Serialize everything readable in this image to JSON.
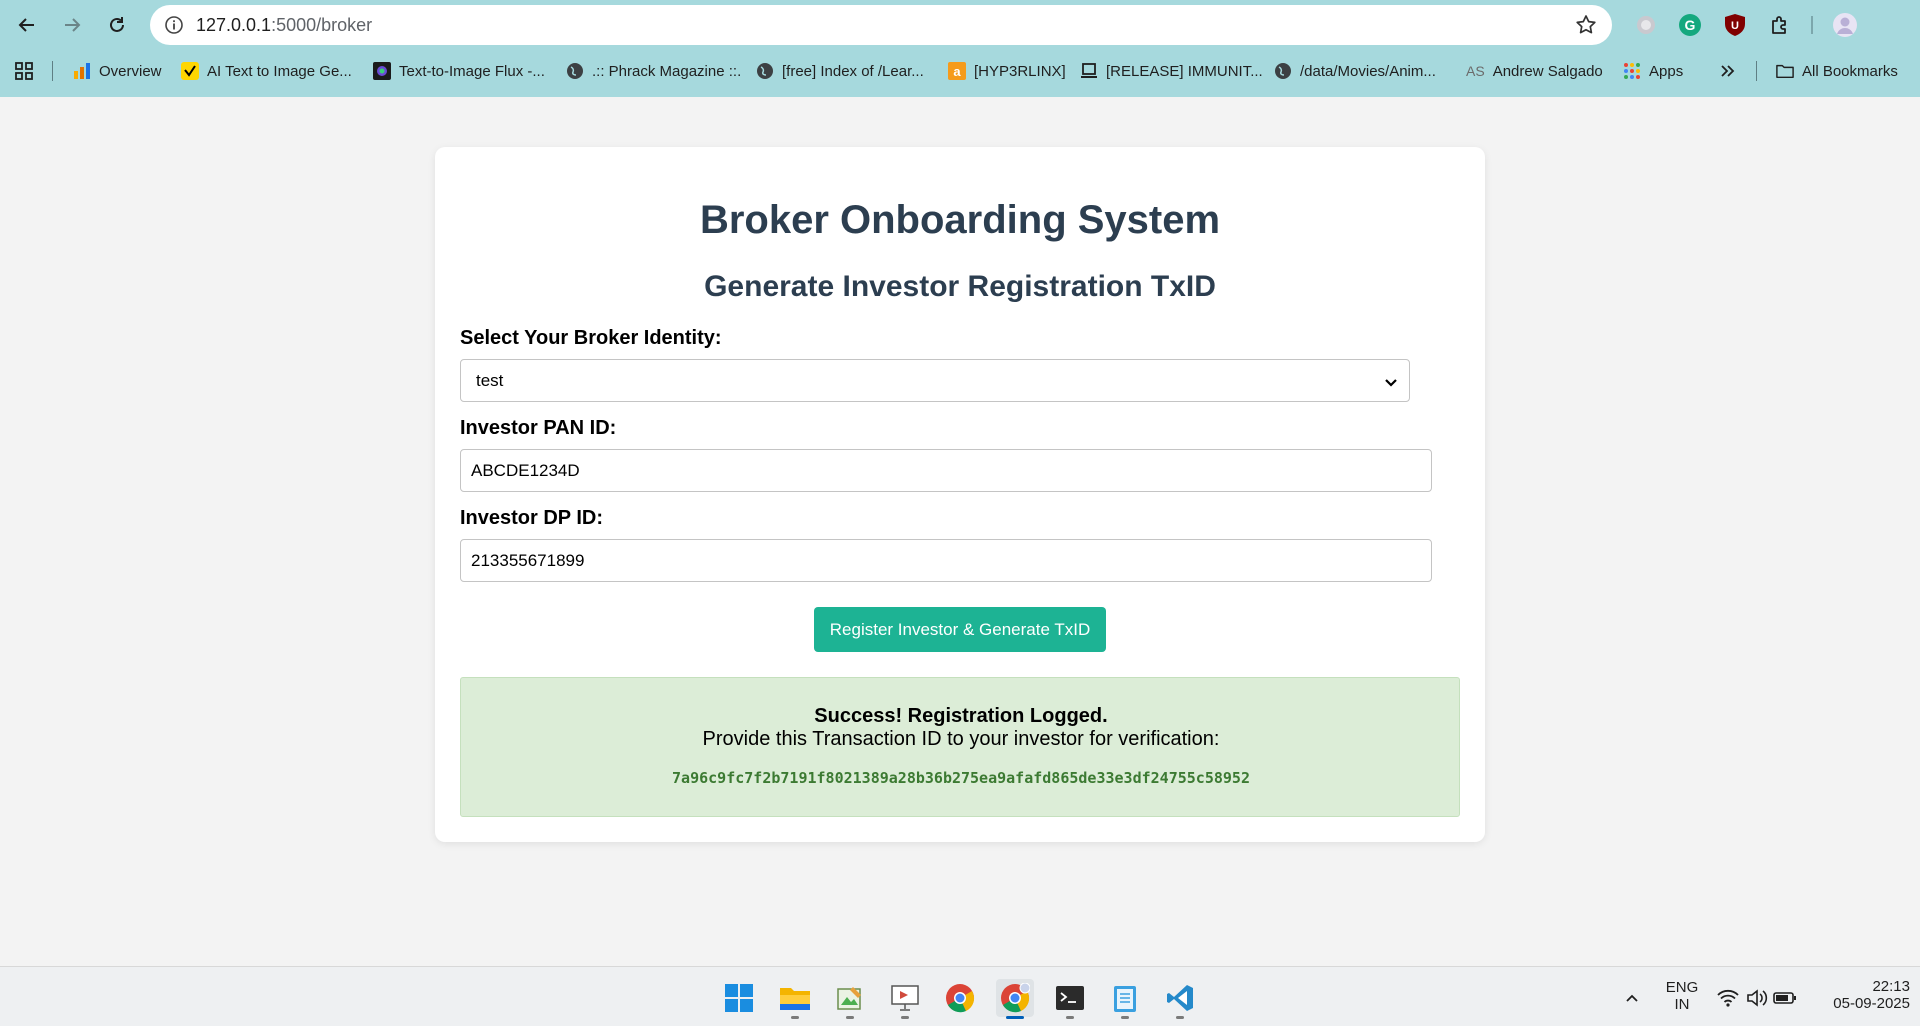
{
  "browser": {
    "url_host": "127.0.0.1",
    "url_path": ":5000/broker",
    "bookmarks": [
      {
        "label": "Overview"
      },
      {
        "label": "AI Text to Image Ge..."
      },
      {
        "label": "Text-to-Image Flux -..."
      },
      {
        "label": ".:: Phrack Magazine ::."
      },
      {
        "label": "[free] Index of /Lear..."
      },
      {
        "label": "[HYP3RLINX]"
      },
      {
        "label": "[RELEASE] IMMUNIT..."
      },
      {
        "label": "/data/Movies/Anim..."
      },
      {
        "label": "Andrew Salgado",
        "prefix": "AS"
      },
      {
        "label": "Apps"
      }
    ],
    "all_bookmarks": "All Bookmarks",
    "ext_u_letter": "U"
  },
  "page": {
    "title": "Broker Onboarding System",
    "subtitle": "Generate Investor Registration TxID",
    "broker_label": "Select Your Broker Identity:",
    "broker_selected": "test",
    "pan_label": "Investor PAN ID:",
    "pan_value": "ABCDE1234D",
    "dp_label": "Investor DP ID:",
    "dp_value": "213355671899",
    "submit_label": "Register Investor & Generate TxID",
    "success_title": "Success! Registration Logged.",
    "success_message": "Provide this Transaction ID to your investor for verification:",
    "txid": "7a96c9fc7f2b7191f8021389a28b36b275ea9afafd865de33e3df24755c58952"
  },
  "taskbar": {
    "lang_top": "ENG",
    "lang_bottom": "IN",
    "time": "22:13",
    "date": "05-09-2025"
  },
  "colors": {
    "accent_button": "#1db394",
    "success_bg": "#dcedd7",
    "txid_text": "#3c7a32",
    "heading": "#2c3e50",
    "chrome_bg": "#a6d9dd"
  }
}
